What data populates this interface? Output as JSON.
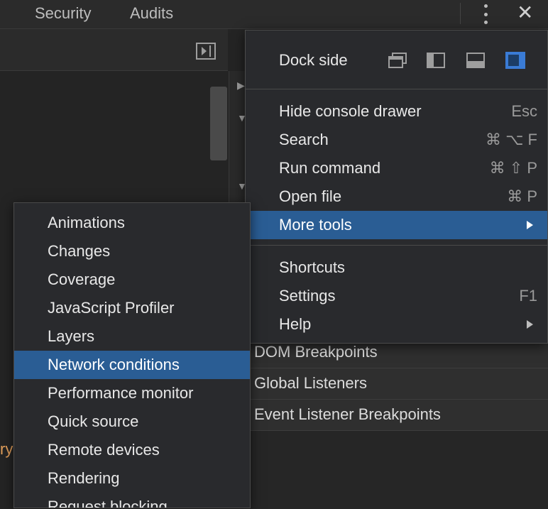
{
  "topbar": {
    "tabs": [
      "Security",
      "Audits"
    ],
    "more_icon": "kebab-menu-icon",
    "close_icon": "close-icon",
    "close_glyph": "✕"
  },
  "left_panel": {
    "sidebar_toggle_icon": "toggle-sidebar-icon",
    "code_fragment": "ry"
  },
  "right_panel": {
    "rows": [
      "DOM Breakpoints",
      "Global Listeners",
      "Event Listener Breakpoints"
    ]
  },
  "main_menu": {
    "dock_side_label": "Dock side",
    "dock_options": [
      "undock-icon",
      "dock-left-icon",
      "dock-bottom-icon",
      "dock-right-icon"
    ],
    "dock_selected": "dock-right-icon",
    "items": [
      {
        "label": "Hide console drawer",
        "shortcut": "Esc"
      },
      {
        "label": "Search",
        "shortcut": "⌘ ⌥ F"
      },
      {
        "label": "Run command",
        "shortcut": "⌘ ⇧ P"
      },
      {
        "label": "Open file",
        "shortcut": "⌘ P"
      },
      {
        "label": "More tools",
        "shortcut": "",
        "submenu": true,
        "selected": true
      },
      {
        "label": "Shortcuts",
        "shortcut": ""
      },
      {
        "label": "Settings",
        "shortcut": "F1"
      },
      {
        "label": "Help",
        "shortcut": "",
        "submenu": true
      }
    ]
  },
  "more_tools_menu": {
    "items": [
      "Animations",
      "Changes",
      "Coverage",
      "JavaScript Profiler",
      "Layers",
      "Network conditions",
      "Performance monitor",
      "Quick source",
      "Remote devices",
      "Rendering",
      "Request blocking"
    ],
    "selected": "Network conditions"
  },
  "colors": {
    "accent_selected": "#2a5d94",
    "menu_bg": "#292a2d",
    "code_orange": "#e4a05c"
  }
}
